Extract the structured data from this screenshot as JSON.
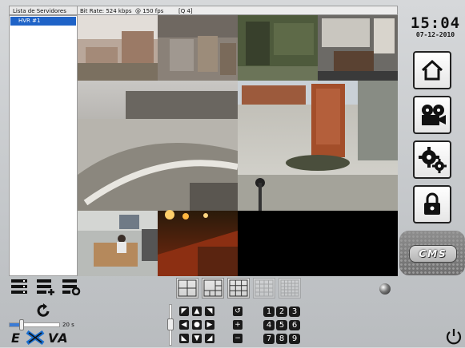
{
  "header": {
    "server_list_title": "Lista de Servidores",
    "bitrate": "Bit Rate: 524 kbps",
    "fps": "@ 150 fps",
    "quality": "[Q 4]"
  },
  "servers": [
    {
      "label": "HVR #1",
      "selected": true
    }
  ],
  "clock": {
    "time": "15:04",
    "date": "07-12-2010"
  },
  "side_buttons": [
    {
      "name": "home-button",
      "icon": "home-icon"
    },
    {
      "name": "camera-button",
      "icon": "film-camera-icon"
    },
    {
      "name": "settings-button",
      "icon": "gears-icon"
    },
    {
      "name": "lock-button",
      "icon": "lock-icon"
    }
  ],
  "cms_badge": "CMS",
  "video_wall": {
    "cameras": [
      {
        "name": "camera-1",
        "scene": "campus buildings aerial"
      },
      {
        "name": "camera-2",
        "scene": "city street aerial"
      },
      {
        "name": "camera-3",
        "scene": "building wall with sign"
      },
      {
        "name": "camera-4",
        "scene": "office interior"
      },
      {
        "name": "camera-5",
        "scene": "snowy plaza"
      },
      {
        "name": "camera-6",
        "scene": "brick tower courtyard"
      },
      {
        "name": "camera-7",
        "scene": "meeting room"
      },
      {
        "name": "camera-8",
        "scene": "night parking lot"
      },
      {
        "name": "camera-9",
        "scene": "no signal"
      }
    ]
  },
  "controls": {
    "group_buttons": [
      "server-list-icon",
      "add-server-icon",
      "server-settings-icon"
    ],
    "refresh_icon": "refresh-icon",
    "timer_label": "20 s",
    "timer_value_fraction": 0.25,
    "layouts": [
      "layout-2x2",
      "layout-1plus5",
      "layout-3x3",
      "layout-4x4-disabled",
      "layout-5x5-disabled"
    ],
    "ptz": {
      "rotate": "↺",
      "plus": "+",
      "minus": "−"
    },
    "keypad": [
      "1",
      "2",
      "3",
      "4",
      "5",
      "6",
      "7",
      "8",
      "9"
    ]
  },
  "brand": {
    "logo_text": "EXVA"
  },
  "colors": {
    "selection": "#1f63c7",
    "wall_bg": "#000000",
    "panel": "#c7cacd"
  }
}
